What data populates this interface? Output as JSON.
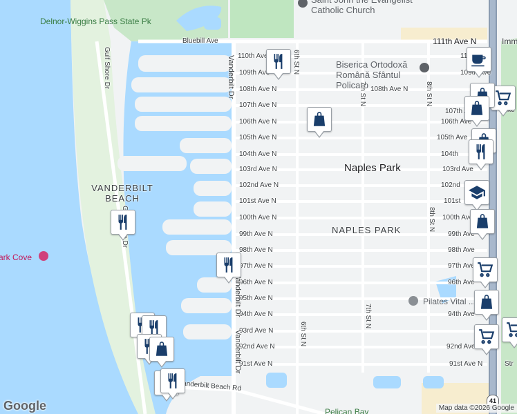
{
  "map": {
    "attribution": "Map data ©2026 Google",
    "logo": "Google",
    "highway_shield": "41",
    "colors": {
      "water": "#aadaff",
      "land": "#f1f3f4",
      "park": "#c4e9c9",
      "sand": "#e4f3e2",
      "road": "#ffffff",
      "major_road": "#f8d97a",
      "icon": "#1a3e6b"
    }
  },
  "labels": {
    "park_delnor": "Delnor-Wiggins Pass State Pk",
    "church_name": "Saint John the Evangelist Catholic Church",
    "church_romanian": "Biserica Ortodoxă Română Sfântul Policarp",
    "vanderbilt_beach": "VANDERBILT BEACH",
    "naples_park_major": "Naples Park",
    "naples_park_area": "NAPLES PARK",
    "park_cove": "Park Cove",
    "pilates": "Pilates Vital ...ss",
    "pelican_bay": "Pelican Bay"
  },
  "streets": {
    "avenues_west": [
      "110th Ave",
      "109th Ave",
      "108th Ave N",
      "107th Ave N",
      "106th Ave N",
      "105th Ave N",
      "104th Ave N",
      "103rd Ave N",
      "102nd Ave N",
      "101st Ave N",
      "100th Ave N",
      "99th Ave N",
      "98th Ave N",
      "97th Ave N",
      "96th Ave N",
      "95th Ave N",
      "94th Ave N",
      "93rd Ave N",
      "92nd Ave N",
      "91st Ave N"
    ],
    "avenues_east": [
      "110th Ave",
      "109th Ave",
      "107th Ave",
      "106th Ave",
      "105th Ave",
      "104th",
      "103rd Ave",
      "102nd",
      "101st",
      "100th Ave",
      "99th Ave",
      "98th Ave",
      "97th Ave",
      "96th Ave",
      "94th Ave",
      "92nd Ave",
      "91st Ave N"
    ],
    "ave_108_mid": "108th Ave N",
    "ave_111": "111th Ave N",
    "imm": "Imm",
    "bluebill": "Bluebill Ave",
    "vanderbilt_dr": "Vanderbilt Dr",
    "vanderbilt_dr_2": "Vanderbilt Dr",
    "vanderbilt_dr_3": "Vanderbilt Dr",
    "gulf_shore": "Gulf Shore Dr",
    "gulf_shore_2": "Gulf Shore Dr",
    "vanderbilt_beach_rd": "Vanderbilt Beach Rd",
    "sixth_st": "6th St N",
    "sixth_st_2": "6th St N",
    "seventh_st": "7th St N",
    "seventh_st_2": "7th St N",
    "eighth_st": "8th St N",
    "eighth_st_2": "8th St N",
    "ave_107_diag": "107th Ave",
    "str": "Str",
    "ke": "ke"
  },
  "markers": [
    {
      "icon": "restaurant-icon",
      "label": "Restaurant"
    },
    {
      "icon": "shopping-bag-icon",
      "label": "Shopping"
    },
    {
      "icon": "restaurant-icon",
      "label": "Restaurant"
    },
    {
      "icon": "restaurant-icon",
      "label": "Restaurant"
    },
    {
      "icon": "coffee-cup-icon",
      "label": "Cafe"
    },
    {
      "icon": "shopping-cart-icon",
      "label": "Grocery"
    },
    {
      "icon": "school-icon",
      "label": "School"
    }
  ]
}
